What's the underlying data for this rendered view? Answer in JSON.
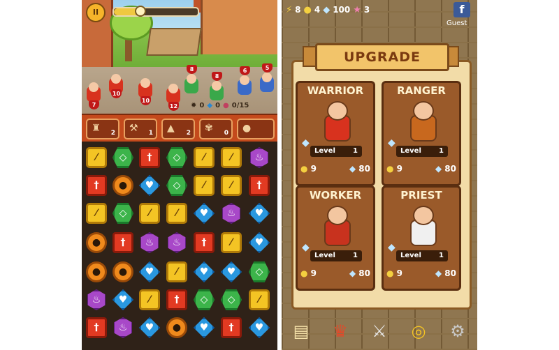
{
  "left": {
    "top_bar": {
      "pause_icon": "pause-icon",
      "wave_progress": 0.3
    },
    "units": {
      "allies": [
        {
          "hp": "7"
        },
        {
          "hp": "10"
        },
        {
          "hp": "10"
        },
        {
          "hp": "12"
        }
      ],
      "enemies": [
        {
          "hp": "8"
        },
        {
          "hp": "8"
        },
        {
          "hp": "6"
        },
        {
          "hp": "5"
        }
      ]
    },
    "resources": {
      "gold": "0",
      "gems": "0",
      "food": "0/15"
    },
    "toolbar": [
      {
        "name": "worker-bag",
        "icon": "bag-icon",
        "count": "2"
      },
      {
        "name": "hammer",
        "icon": "hammer-icon",
        "count": "1"
      },
      {
        "name": "anvil",
        "icon": "anvil-icon",
        "count": "2"
      },
      {
        "name": "wheat",
        "icon": "wheat-icon",
        "count": "0"
      },
      {
        "name": "food",
        "icon": "cake-icon",
        "count": ""
      }
    ],
    "board": [
      [
        "yellow-gun",
        "green-gem",
        "red-sword",
        "green-gem",
        "yellow-gun",
        "yellow-gun",
        "purple-cake"
      ],
      [
        "red-sword",
        "orange-bomb",
        "blue-heart",
        "green-gem",
        "yellow-gun",
        "yellow-gun",
        "red-sword"
      ],
      [
        "yellow-gun",
        "green-gem",
        "yellow-gun",
        "yellow-gun",
        "blue-heart",
        "purple-cake",
        "blue-heart"
      ],
      [
        "orange-bomb",
        "red-sword",
        "purple-cake",
        "purple-cake",
        "red-sword",
        "yellow-gun",
        "blue-heart"
      ],
      [
        "orange-bomb",
        "orange-bomb",
        "blue-heart",
        "yellow-gun",
        "blue-heart",
        "blue-heart",
        "green-gem"
      ],
      [
        "purple-cake",
        "blue-heart",
        "yellow-gun",
        "red-sword",
        "green-gem",
        "green-gem",
        "yellow-gun"
      ],
      [
        "red-sword",
        "purple-cake",
        "blue-heart",
        "orange-bomb",
        "blue-heart",
        "red-sword",
        "blue-heart"
      ]
    ]
  },
  "right": {
    "top_bar": {
      "lightning": "8",
      "coins": "4",
      "diamonds": "100",
      "stars": "3",
      "facebook_label": "f",
      "guest_label": "Guest"
    },
    "title": "UPGRADE",
    "cards": [
      {
        "name": "WARRIOR",
        "level_label": "Level",
        "level": "1",
        "coin_cost": "9",
        "gem_cost": "80",
        "color": "#d8321e"
      },
      {
        "name": "RANGER",
        "level_label": "Level",
        "level": "1",
        "coin_cost": "9",
        "gem_cost": "80",
        "color": "#c8681e"
      },
      {
        "name": "WORKER",
        "level_label": "Level",
        "level": "1",
        "coin_cost": "9",
        "gem_cost": "80",
        "color": "#c8321e"
      },
      {
        "name": "PRIEST",
        "level_label": "Level",
        "level": "1",
        "coin_cost": "9",
        "gem_cost": "80",
        "color": "#f0f0f0"
      }
    ],
    "bottom_nav": [
      "map-icon",
      "crown-icon",
      "sword-upgrade-icon",
      "coins-icon",
      "gear-icon"
    ]
  },
  "colors": {
    "wood": "#9a5a2a",
    "parchment": "#f2dca8",
    "banner": "#f2c46a",
    "toolbar": "#c44a1c"
  }
}
